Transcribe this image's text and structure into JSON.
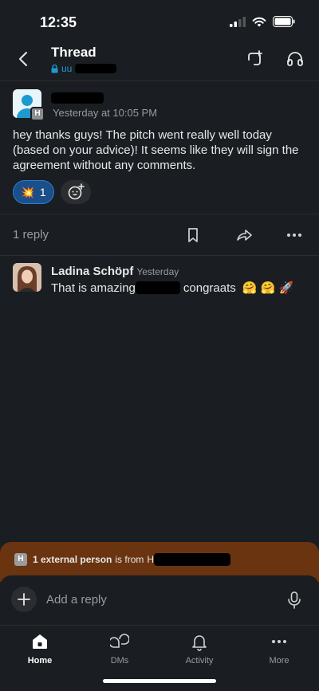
{
  "status_bar": {
    "time": "12:35"
  },
  "header": {
    "title": "Thread",
    "channel_prefix": "uu"
  },
  "post": {
    "author_badge": "H",
    "timestamp": "Yesterday at 10:05 PM",
    "message": "hey thanks guys!  The pitch went really well today (based on your advice)!  It seems like they will sign the agreement without any comments.",
    "reaction": {
      "emoji": "💥",
      "count": "1"
    }
  },
  "thread_actions": {
    "reply_count": "1 reply"
  },
  "reply": {
    "author": "Ladina Schöpf",
    "timestamp": "Yesterday",
    "text_before": "That is amazing",
    "text_after": "congraats",
    "emojis": "🤗 🤗 🚀"
  },
  "external_banner": {
    "badge": "H",
    "bold_text": "1 external person",
    "text": "is from",
    "org_initial": "H"
  },
  "composer": {
    "placeholder": "Add a reply"
  },
  "tabs": [
    {
      "label": "Home",
      "icon": "home-icon",
      "active": true
    },
    {
      "label": "DMs",
      "icon": "dms-icon",
      "active": false
    },
    {
      "label": "Activity",
      "icon": "bell-icon",
      "active": false
    },
    {
      "label": "More",
      "icon": "more-icon",
      "active": false
    }
  ],
  "colors": {
    "background": "#1a1d21",
    "link": "#1d9bd1",
    "reaction_active": "#1b4f8a",
    "external_banner": "#6a3410"
  }
}
